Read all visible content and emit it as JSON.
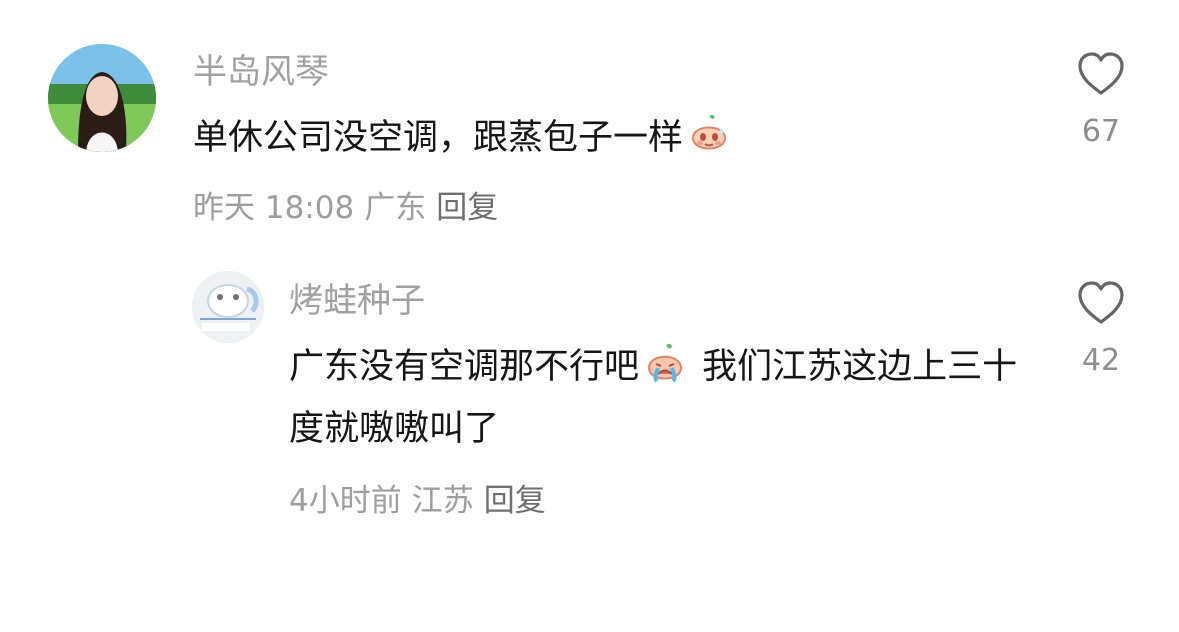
{
  "comments": [
    {
      "username": "半岛风琴",
      "text_before_emoji": "单休公司没空调，跟蒸包子一样",
      "emoji": "sweating-bun-emoji",
      "time": "昨天 18:08",
      "location": "广东",
      "reply_label": "回复",
      "like_count": "67"
    },
    {
      "username": "烤蛙种子",
      "text_before_emoji": "广东没有空调那不行吧",
      "emoji": "crying-bun-emoji",
      "text_after_emoji": " 我们江苏这边上三十度就嗷嗷叫了",
      "time": "4小时前",
      "location": "江苏",
      "reply_label": "回复",
      "like_count": "42"
    }
  ],
  "colors": {
    "username": "#a1a1a1",
    "text": "#161616",
    "meta": "#9e9e9e",
    "reply": "#6f6f6f",
    "like": "#8e8e8e"
  }
}
